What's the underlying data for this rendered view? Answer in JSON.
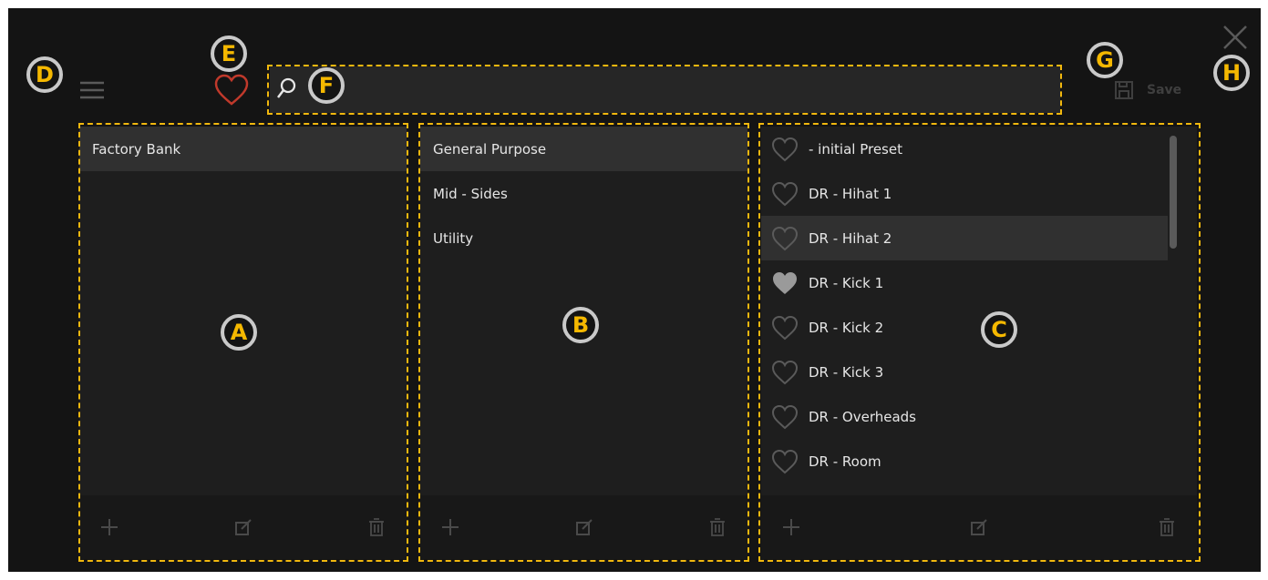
{
  "top": {
    "save_label": "Save"
  },
  "callouts": {
    "A": "A",
    "B": "B",
    "C": "C",
    "D": "D",
    "E": "E",
    "F": "F",
    "G": "G",
    "H": "H"
  },
  "banks": [
    "Factory Bank"
  ],
  "categories": [
    "General Purpose",
    "Mid - Sides",
    "Utility"
  ],
  "presets": [
    {
      "name": "- initial Preset",
      "favorite": false
    },
    {
      "name": "DR - Hihat 1",
      "favorite": false
    },
    {
      "name": "DR - Hihat 2",
      "favorite": false
    },
    {
      "name": "DR - Kick 1",
      "favorite": true
    },
    {
      "name": "DR - Kick 2",
      "favorite": false
    },
    {
      "name": "DR - Kick 3",
      "favorite": false
    },
    {
      "name": "DR - Overheads",
      "favorite": false
    },
    {
      "name": "DR - Room",
      "favorite": false
    }
  ],
  "colors": {
    "accent": "#f1b80e",
    "favorite_heart": "#c0392b"
  }
}
